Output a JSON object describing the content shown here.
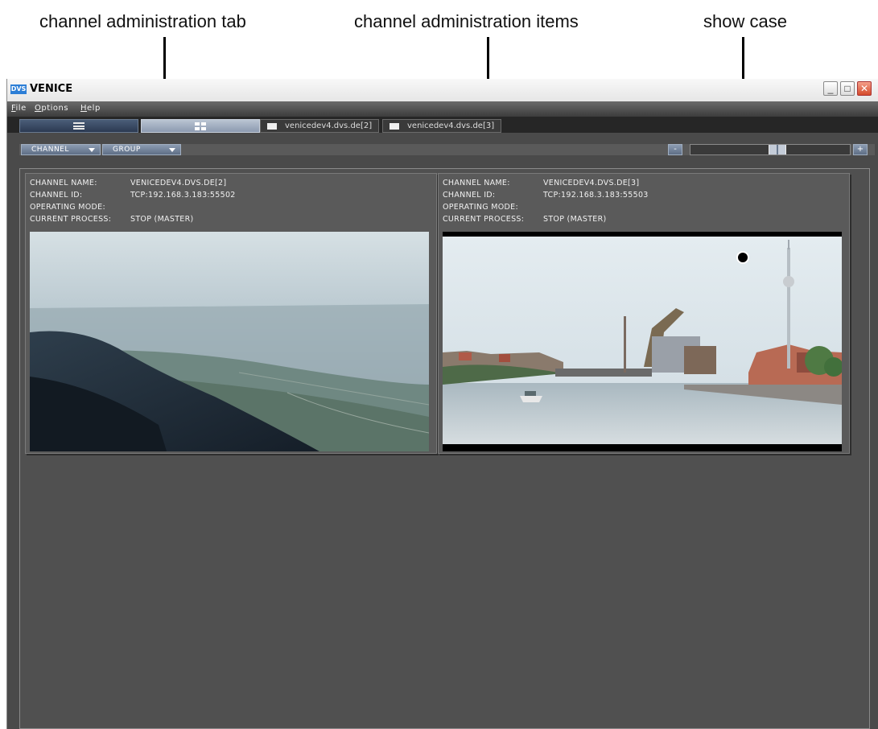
{
  "annotations": {
    "tab": "channel administration tab",
    "items": "channel administration items",
    "showcase": "show case"
  },
  "window": {
    "title": "VENICE",
    "logo_text": "DVS",
    "controls": {
      "minimize": "_",
      "maximize": "□",
      "close": "✕"
    }
  },
  "menu": {
    "file": "File",
    "options": "Options",
    "help": "Help"
  },
  "channel_tabs": [
    "venicedev4.dvs.de[2]",
    "venicedev4.dvs.de[3]"
  ],
  "toolbar": {
    "channel_dropdown": "CHANNEL",
    "group_dropdown": "GROUP",
    "zoom_out": "-",
    "zoom_in": "+",
    "zoom_level": 0.55
  },
  "info_labels": {
    "name": "CHANNEL NAME:",
    "id": "CHANNEL ID:",
    "mode": "OPERATING MODE:",
    "process": "CURRENT PROCESS:"
  },
  "channels": [
    {
      "name": "VENICEDEV4.DVS.DE[2]",
      "id": "TCP:192.168.3.183:55502",
      "mode": "",
      "process": "STOP (MASTER)"
    },
    {
      "name": "VENICEDEV4.DVS.DE[3]",
      "id": "TCP:192.168.3.183:55503",
      "mode": "",
      "process": "STOP (MASTER)"
    }
  ],
  "colors": {
    "window_bg": "#4a4a4a",
    "active_tab": "#9ca8ba",
    "accent": "#2c7ed6"
  }
}
